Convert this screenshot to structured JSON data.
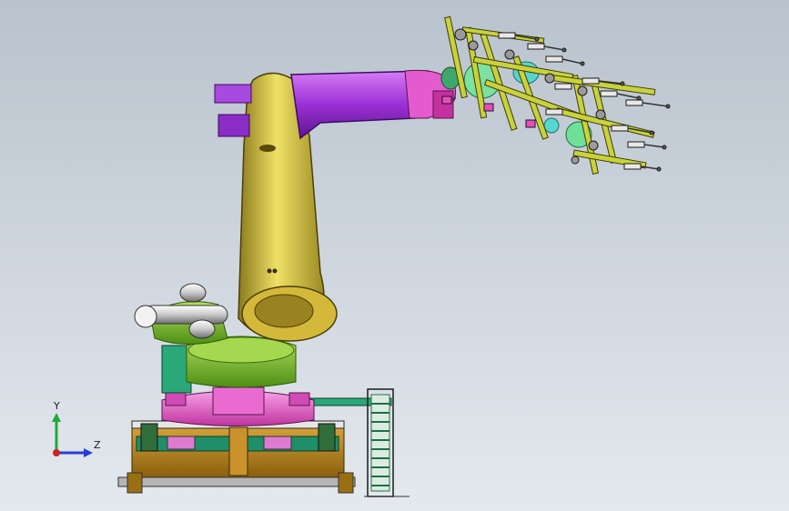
{
  "viewport": {
    "background_top": "#b9c3cd",
    "background_bottom": "#e4e9ee"
  },
  "model": {
    "icon": "industrial-robot-arm-assembly",
    "colors": {
      "upper_arm": "#9b30d6",
      "lower_arm": "#d8c43a",
      "turret": "#78b828",
      "base_plate": "#e050c0",
      "frame": "#b8860b",
      "teal_parts": "#2aa878",
      "gripper": "#c8d23c"
    }
  },
  "triad": {
    "y_label": "Y",
    "z_label": "Z",
    "y_color": "#1faa3a",
    "z_color": "#2a3cd8",
    "origin_color": "#d02020"
  }
}
